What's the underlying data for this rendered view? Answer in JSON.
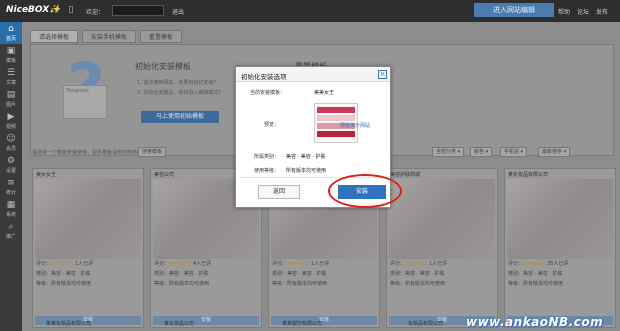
{
  "topbar": {
    "logo_text": "NiceBOX",
    "logo_suffix": "✨",
    "welcome": "欢迎：",
    "user": "",
    "logout": "退出",
    "enter_site_button": "进入网站编辑",
    "links": [
      "帮助",
      "论坛",
      "发布"
    ]
  },
  "sidebar": {
    "items": [
      {
        "label": "首页",
        "icon": "home-icon",
        "glyph": "⌂"
      },
      {
        "label": "模板",
        "icon": "template-icon",
        "glyph": "▣"
      },
      {
        "label": "文章",
        "icon": "article-icon",
        "glyph": "☰"
      },
      {
        "label": "图片",
        "icon": "image-icon",
        "glyph": "▤"
      },
      {
        "label": "视频",
        "icon": "video-icon",
        "glyph": "▶"
      },
      {
        "label": "会员",
        "icon": "member-icon",
        "glyph": "☺"
      },
      {
        "label": "设置",
        "icon": "settings-icon",
        "glyph": "⚙"
      },
      {
        "label": "统计",
        "icon": "stats-icon",
        "glyph": "≡"
      },
      {
        "label": "系统",
        "icon": "system-icon",
        "glyph": "▦"
      },
      {
        "label": "推广",
        "icon": "promote-icon",
        "glyph": "⌕"
      }
    ]
  },
  "tabs": [
    "请选择模板",
    "安装手机模板",
    "重置模板"
  ],
  "panel": {
    "card_label": "Template",
    "title": "初始化安装模板",
    "line1": "1. 首次使用网站，你要初始化安装？",
    "line2": "2. 初始化安装后，你将进入编辑模式？",
    "button": "马上使用初始模板",
    "right_title": "重置模板"
  },
  "filter": {
    "text": "请选择一个模板安装使用，更多模板请到应用商店",
    "button": "搜索模板",
    "dropdowns": [
      "全部分类 ▾",
      "颜色 ▾",
      "手机站 ▾",
      "最新排序 ▾"
    ]
  },
  "cards": [
    {
      "title": "美女女王",
      "rating_text": "评分：",
      "stars": "★★☆☆☆",
      "count": "1人已评",
      "category": "类别：美容 · 美容 · 护肤",
      "level": "等级：所有版本均可使用",
      "button": "安装"
    },
    {
      "title": "美容公司",
      "rating_text": "评分：",
      "stars": "★★★★☆",
      "count": "4人已评",
      "category": "类别：美容 · 美容 · 护肤",
      "level": "等级：所有版本均可使用",
      "button": "安装"
    },
    {
      "title": "",
      "rating_text": "评分：",
      "stars": "★★★★☆",
      "count": "1人已评",
      "category": "类别：美容 · 美容 · 护肤",
      "level": "等级：所有版本均可使用",
      "button": "安装"
    },
    {
      "title": "美容护肤商城",
      "rating_text": "评分：",
      "stars": "★★★★☆",
      "count": "1人已评",
      "category": "类别：美容 · 美容 · 护肤",
      "level": "等级：所有版本均可使用",
      "button": "安装"
    },
    {
      "title": "某化妆品有限公司",
      "rating_text": "评分：",
      "stars": "★★★★★",
      "count": "35人已评",
      "category": "类别：美容 · 美容 · 护肤",
      "level": "等级：所有版本均可使用",
      "button": "安装"
    }
  ],
  "row2": [
    "某某化妆品有限公司",
    "某化妆品公司",
    "某某服饮有限公司",
    "化妆品有限公司"
  ],
  "modal": {
    "title": "初始化安装选项",
    "current_label": "当前安装模板：",
    "current_value": "美美女王",
    "preview_label": "预览：",
    "preview_link": "预览演示网站",
    "category_label": "所属类别：",
    "category_value": "美容 · 美容 · 护肤",
    "usage_label": "使用等级：",
    "usage_value": "所有版本均可使用",
    "back_button": "返回",
    "install_button": "安装"
  },
  "watermark": "www.ankaoNB.com",
  "colors": {
    "accent": "#2f73bf",
    "highlight_ring": "#d9241c",
    "topbar": "#2e2e2e"
  }
}
